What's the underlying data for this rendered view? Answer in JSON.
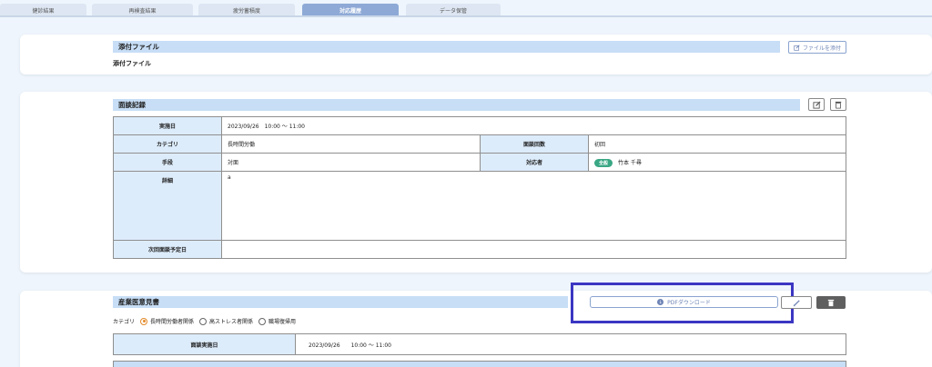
{
  "tabs": [
    {
      "label": "健診結果"
    },
    {
      "label": "再検査結果"
    },
    {
      "label": "疲労蓄積度"
    },
    {
      "label": "対応履歴"
    },
    {
      "label": "データ保管"
    }
  ],
  "attachment": {
    "header": "添付ファイル",
    "button_label": "ファイルを添付",
    "body_label": "添付ファイル"
  },
  "interview": {
    "header": "面談記録",
    "labels": {
      "date": "実施日",
      "category": "カテゴリ",
      "count": "面談回数",
      "method": "手段",
      "responder": "対応者",
      "detail": "詳細",
      "next": "次回面談予定日"
    },
    "values": {
      "date": "2023/09/26　10:00 ～ 11:00",
      "category": "長時間労働",
      "count": "初回",
      "method": "対面",
      "responder_badge": "全般",
      "responder": "竹本 千尋",
      "detail": "a",
      "next": ""
    }
  },
  "opinion": {
    "header": "産業医意見書",
    "pdf_label": "PDFダウンロード",
    "category_label": "カテゴリ",
    "radios": [
      {
        "label": "長時間労働者関係",
        "checked": true
      },
      {
        "label": "高ストレス者関係",
        "checked": false
      },
      {
        "label": "職場復帰用",
        "checked": false
      }
    ],
    "date_label": "面談実施日",
    "date_value": "2023/09/26　　10:00 ～ 11:00"
  },
  "colors": {
    "accent": "#8ea9d6",
    "section_header": "#c7def6",
    "label_cell": "#ddecfb",
    "badge": "#3aa784",
    "highlight": "#3b36c2",
    "radio_checked": "#e38a2a"
  }
}
